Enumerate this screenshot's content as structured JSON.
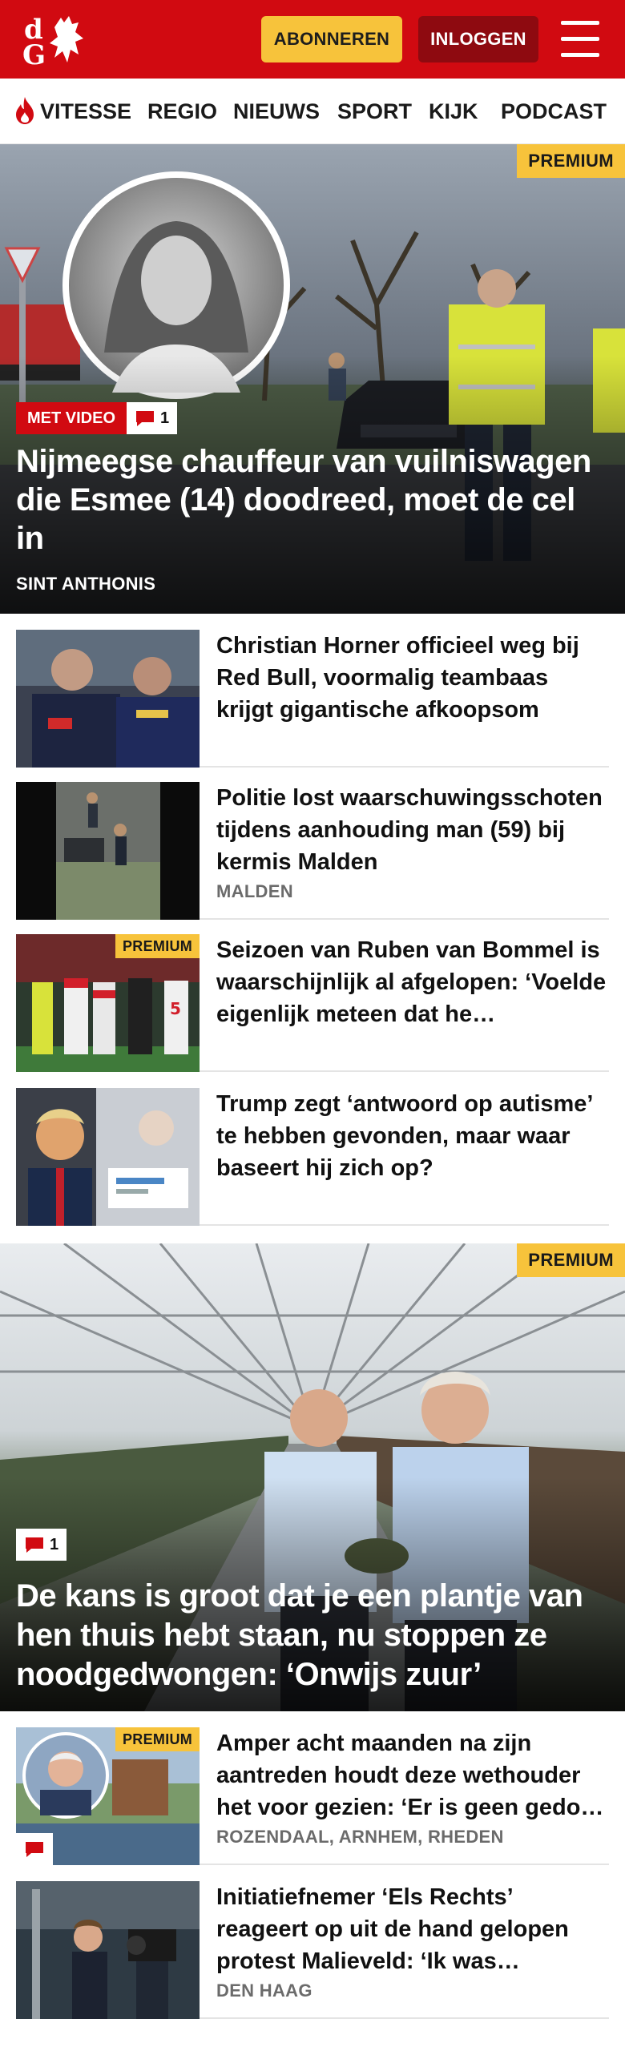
{
  "header": {
    "logo_text": "dG",
    "subscribe_label": "ABONNEREN",
    "login_label": "INLOGGEN"
  },
  "nav": {
    "items": [
      "VITESSE",
      "REGIO",
      "NIEUWS",
      "SPORT",
      "KIJK",
      "PODCAST"
    ]
  },
  "hero": {
    "premium_label": "PREMIUM",
    "video_label": "MET VIDEO",
    "comment_count": "1",
    "title": "Nijmeegse chauffeur van vuilniswa­gen die Esmee (14) doodreed, moet de cel in",
    "location": "SINT ANTHONIS"
  },
  "articles": [
    {
      "title": "Christian Horner officieel weg bij Red Bull, voormalig teambaas krijgt gigantische afkoopsom",
      "location": "",
      "premium": ""
    },
    {
      "title": "Politie lost waarschuwingsscho­ten tijdens aanhouding man (59) bij kermis Malden",
      "location": "MALDEN",
      "premium": ""
    },
    {
      "title": "Seizoen van Ruben van Bommel is waarschijnlijk al afgelopen: ‘Voelde eigenlijk meteen dat he…",
      "location": "",
      "premium": "PREMIUM"
    },
    {
      "title": "Trump zegt ‘antwoord op autisme’ te hebben gevonden, maar waar baseert hij zich op?",
      "location": "",
      "premium": ""
    }
  ],
  "hero2": {
    "premium_label": "PREMIUM",
    "comment_count": "1",
    "title": "De kans is groot dat je een plantje van hen thuis hebt staan, nu stoppen ze noodgedwongen: ‘Onwijs zuur’"
  },
  "articles2": [
    {
      "title": "Amper acht maanden na zijn aantreden houdt deze wethouder het voor gezien: ‘Er is geen gedo…",
      "location": "ROZENDAAL, ARNHEM, RHEDEN",
      "premium": "PREMIUM"
    },
    {
      "title": "Initiatiefnemer ‘Els Rechts’ reageert op uit de hand gelopen protest Malieveld: ‘Ik was…",
      "location": "DEN HAAG",
      "premium": ""
    }
  ],
  "colors": {
    "brand_red": "#d10a11",
    "dark_red": "#8e0a10",
    "premium_yellow": "#f7c33b"
  }
}
